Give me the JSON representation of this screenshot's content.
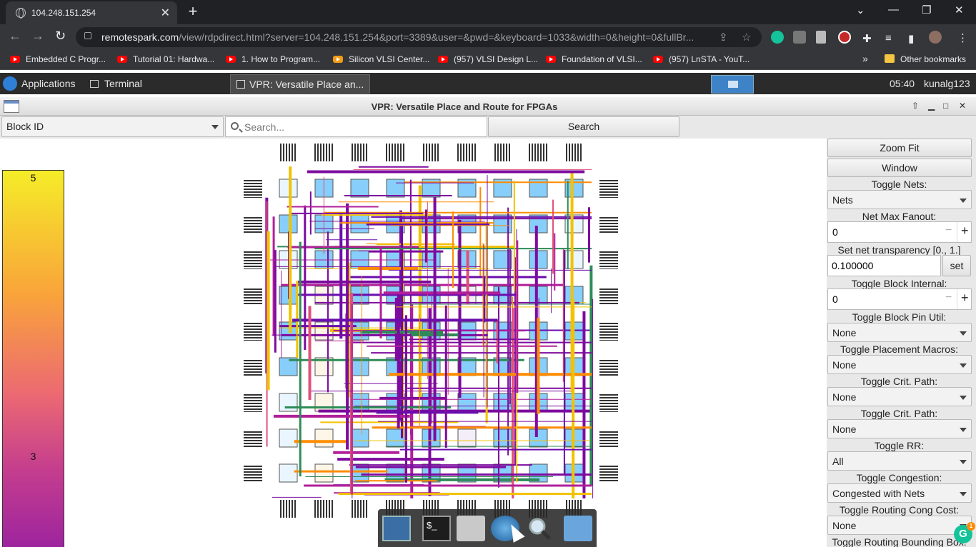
{
  "browser": {
    "tab_title": "104.248.151.254",
    "tab_close": "✕",
    "new_tab": "+",
    "url_host": "remotespark.com",
    "url_rest": "/view/rdpdirect.html?server=104.248.151.254&port=3389&user=&pwd=&keyboard=1033&width=0&height=0&fullBr...",
    "bookmarks": [
      "Embedded C Progr...",
      "Tutorial 01: Hardwa...",
      "1. How to Program...",
      "Silicon VLSI Center...",
      "(957) VLSI Design L...",
      "Foundation of VLSI...",
      "(957) LnSTA - YouT..."
    ],
    "bookmarks_more": "»",
    "other_bookmarks": "Other bookmarks"
  },
  "desktop_panel": {
    "applications": "Applications",
    "terminal": "Terminal",
    "active_task": "VPR: Versatile Place an...",
    "clock": "05:40",
    "user": "kunalg123"
  },
  "window": {
    "title": "VPR: Versatile Place and Route for FPGAs"
  },
  "toolbar": {
    "search_type": "Block ID",
    "search_placeholder": "Search...",
    "search_button": "Search"
  },
  "legend": {
    "top_label": "5",
    "mid_label": "3",
    "colors": [
      "#f5ec28",
      "#f9a43a",
      "#ec6a72",
      "#c43d8e",
      "#9a22a0"
    ]
  },
  "sidebar": {
    "zoom_fit": "Zoom Fit",
    "window": "Window",
    "toggle_nets_label": "Toggle Nets:",
    "toggle_nets_value": "Nets",
    "net_max_fanout_label": "Net Max Fanout:",
    "net_max_fanout_value": "0",
    "net_transparency_label": "Set net transparency [0., 1.]",
    "net_transparency_value": "0.100000",
    "net_transparency_set": "set",
    "block_internal_label": "Toggle Block Internal:",
    "block_internal_value": "0",
    "block_pin_util_label": "Toggle Block Pin Util:",
    "block_pin_util_value": "None",
    "placement_macros_label": "Toggle Placement Macros:",
    "placement_macros_value": "None",
    "crit_path_label_1": "Toggle Crit. Path:",
    "crit_path_value_1": "None",
    "crit_path_label_2": "Toggle Crit. Path:",
    "crit_path_value_2": "None",
    "rr_label": "Toggle RR:",
    "rr_value": "All",
    "congestion_label": "Toggle Congestion:",
    "congestion_value": "Congested with Nets",
    "routing_cong_cost_label": "Toggle Routing Cong Cost:",
    "routing_cong_cost_value": "None",
    "routing_bbox_label": "Toggle Routing Bounding Box:"
  },
  "colors": {
    "clb_fill": "#87cefa",
    "net_purple": "#7d0b9e",
    "net_pink": "#e0507a",
    "net_yellow": "#f2c200",
    "net_orange": "#ff8c00"
  }
}
